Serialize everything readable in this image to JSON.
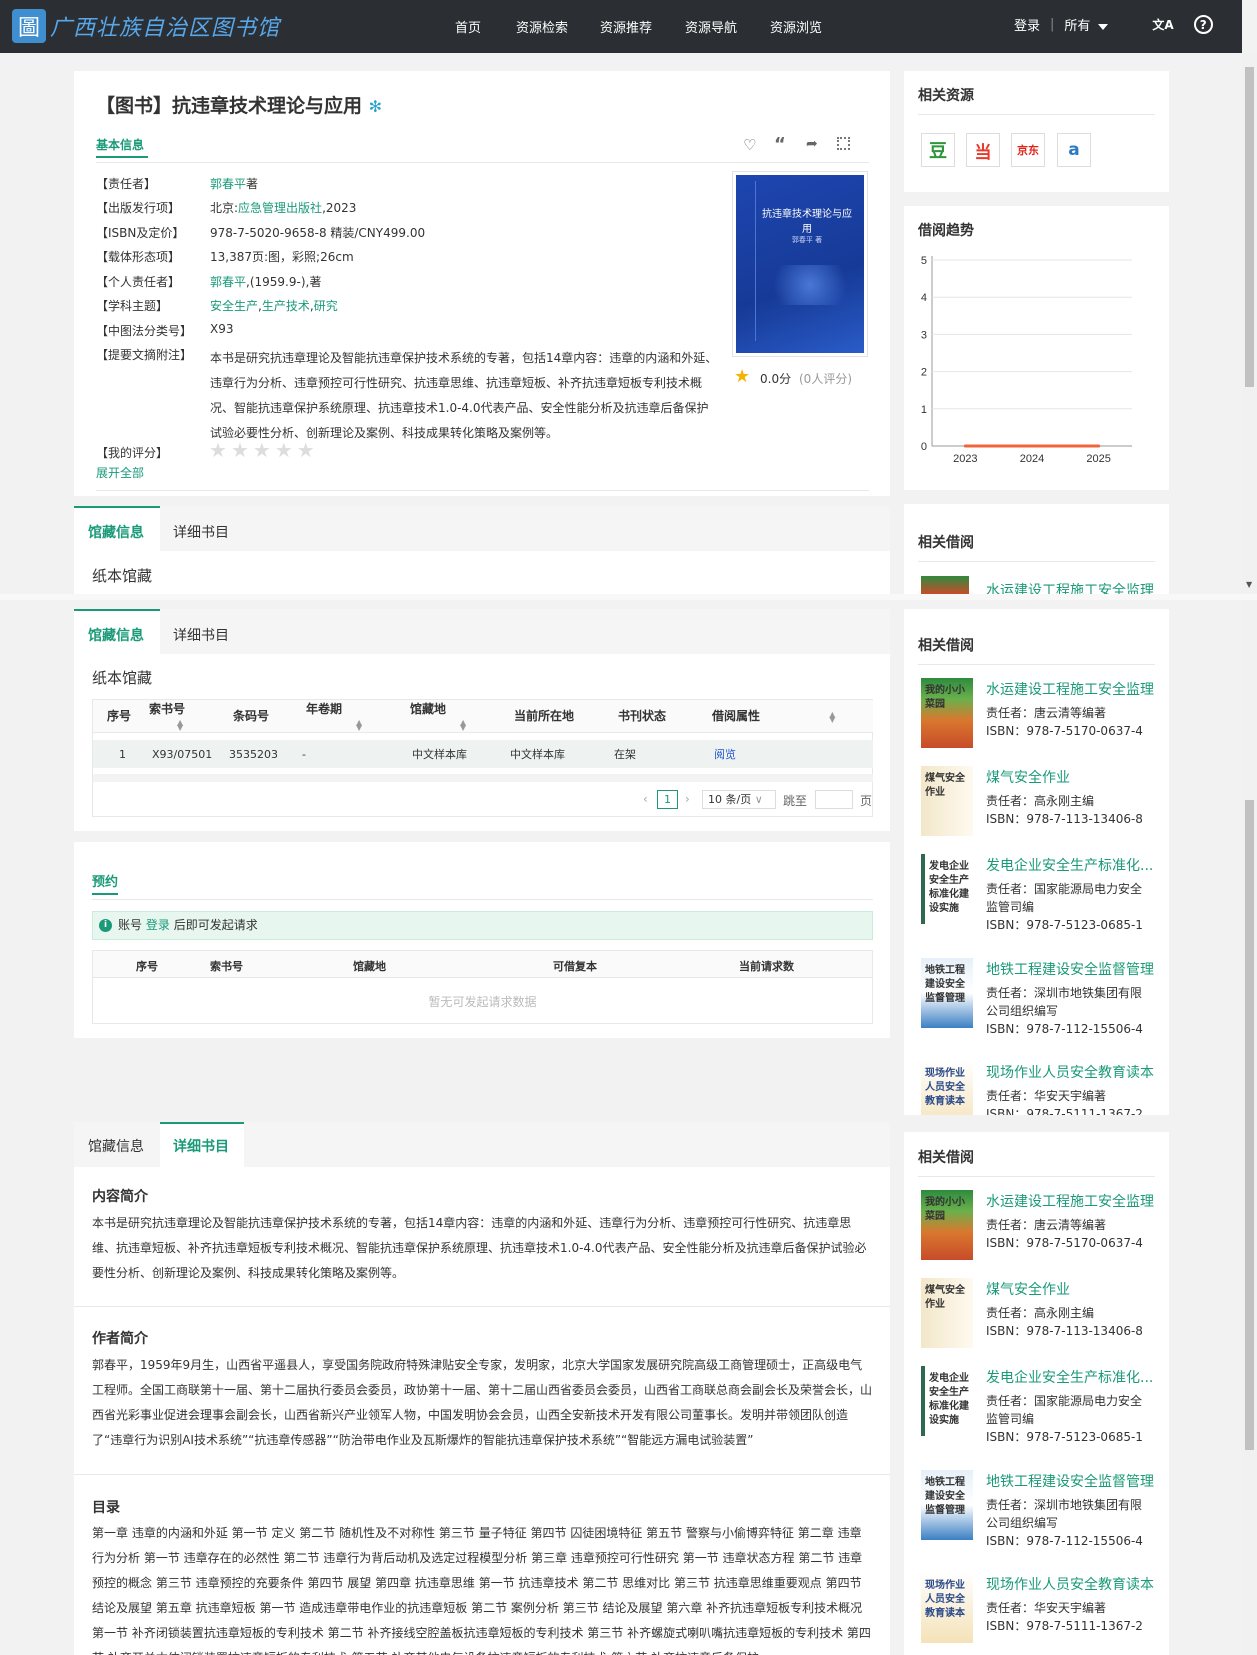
{
  "header": {
    "library_name": "广西壮族自治区图书馆",
    "logo_char": "圖",
    "nav": [
      "首页",
      "资源检索",
      "资源推荐",
      "资源导航",
      "资源浏览"
    ],
    "login": "登录",
    "scope": "所有",
    "lang_icon": "文A",
    "help_icon": "?"
  },
  "book": {
    "title": "【图书】抗违章技术理论与应用",
    "basic_tab": "基本信息",
    "fields": [
      {
        "label": "【责任者】",
        "value": "郭春平著"
      },
      {
        "label": "【出版发行项】",
        "value": "北京:应急管理出版社,2023"
      },
      {
        "label": "【ISBN及定价】",
        "value": "978-7-5020-9658-8 精装/CNY499.00"
      },
      {
        "label": "【载体形态项】",
        "value": "13,387页:图，彩照;26cm"
      },
      {
        "label": "【个人责任者】",
        "value": "郭春平,(1959.9-),著"
      },
      {
        "label": "【学科主题】",
        "value": "安全生产,生产技术,研究"
      },
      {
        "label": "【中图法分类号】",
        "value": "X93"
      },
      {
        "label": "【提要文摘附注】",
        "value": "本书是研究抗违章理论及智能抗违章保护技术系统的专著，包括14章内容：违章的内涵和外延、违章行为分析、违章预控可行性研究、抗违章思维、抗违章短板、补齐抗违章短板专利技术概况、智能抗违章保护系统原理、抗违章技术1.0-4.0代表产品、安全性能分析及抗违章后备保护试验必要性分析、创新理论及案例、科技成果转化策略及案例等。"
      },
      {
        "label": "【我的评分】",
        "value": ""
      }
    ],
    "author_link": "郭春平",
    "author_suffix": "著",
    "pub_prefix": "北京:",
    "pub_link": "应急管理出版社",
    "pub_suffix": ",2023",
    "pers_link": "郭春平",
    "pers_suffix": ",(1959.9-),著",
    "subj_links": [
      "安全生产",
      "生产技术",
      "研究"
    ],
    "expand": "展开全部",
    "rating": "0.0分",
    "rating_count": "(0人评分)",
    "cover_title": "抗违章技术理论与应用",
    "cover_author": "郭春平 著"
  },
  "related_resources": {
    "title": "相关资源",
    "sites": [
      "豆",
      "当",
      "京东",
      "a"
    ]
  },
  "trend": {
    "title": "借阅趋势"
  },
  "chart_data": {
    "type": "line",
    "x": [
      "2023",
      "2024",
      "2025"
    ],
    "series": [
      {
        "values": [
          0,
          0,
          0
        ]
      }
    ],
    "ylim": [
      0,
      5
    ],
    "yticks": [
      0,
      1,
      2,
      3,
      4,
      5
    ],
    "xlabel": "",
    "ylabel": "",
    "color": "#f0643c"
  },
  "holdings": {
    "tabs": [
      "馆藏信息",
      "详细书目"
    ],
    "paper": "纸本馆藏",
    "columns": [
      "序号",
      "索书号",
      "条码号",
      "年卷期",
      "馆藏地",
      "当前所在地",
      "书刊状态",
      "借阅属性"
    ],
    "rows": [
      [
        "1",
        "X93/07501",
        "3535203",
        "-",
        "中文样本库",
        "中文样本库",
        "在架",
        "阅览"
      ]
    ],
    "page": "1",
    "page_size": "10 条/页",
    "goto": "跳至",
    "page_unit": "页"
  },
  "reserve": {
    "title": "预约",
    "notice_prefix": "账号",
    "notice_link": "登录",
    "notice_suffix": "后即可发起请求",
    "columns": [
      "序号",
      "索书号",
      "馆藏地",
      "可借复本",
      "当前请求数"
    ],
    "empty": "暂无可发起请求数据"
  },
  "detail": {
    "intro_title": "内容简介",
    "intro": "本书是研究抗违章理论及智能抗违章保护技术系统的专著，包括14章内容：违章的内涵和外延、违章行为分析、违章预控可行性研究、抗违章思维、抗违章短板、补齐抗违章短板专利技术概况、智能抗违章保护系统原理、抗违章技术1.0-4.0代表产品、安全性能分析及抗违章后备保护试验必要性分析、创新理论及案例、科技成果转化策略及案例等。",
    "author_title": "作者简介",
    "author": "郭春平，1959年9月生，山西省平遥县人，享受国务院政府特殊津贴安全专家，发明家，北京大学国家发展研究院高级工商管理硕士，正高级电气工程师。全国工商联第十一届、第十二届执行委员会委员，政协第十一届、第十二届山西省委员会委员，山西省工商联总商会副会长及荣誉会长，山西省光彩事业促进会理事会副会长，山西省新兴产业领军人物，中国发明协会会员，山西全安新技术开发有限公司董事长。发明并带领团队创造了“违章行为识别AI技术系统”“抗违章传感器”“防治带电作业及瓦斯爆炸的智能抗违章保护技术系统”“智能远方漏电试验装置”",
    "toc_title": "目录",
    "toc": "第一章 违章的内涵和外延 第一节 定义 第二节 随机性及不对称性 第三节 量子特征 第四节 囚徒困境特征 第五节 警察与小偷博弈特征 第二章 违章行为分析 第一节 违章存在的必然性 第二节 违章行为背后动机及选定过程模型分析 第三章 违章预控可行性研究 第一节 违章状态方程 第二节 违章预控的概念 第三节 违章预控的充要条件 第四节 展望 第四章 抗违章思维 第一节 抗违章技术 第二节 思维对比 第三节 抗违章思维重要观点 第四节 结论及展望 第五章 抗违章短板 第一节 造成违章带电作业的抗违章短板 第二节 案例分析 第三节 结论及展望 第六章 补齐抗违章短板专利技术概况 第一节 补齐闭锁装置抗违章短板的专利技术 第二节 补齐接线空腔盖板抗违章短板的专利技术 第三节 补齐螺旋式喇叭嘴抗违章短板的专利技术 第四节 补齐开关本体闭锁装置抗违章短板的专利技术 第五节 补齐其他电气设备抗违章短板的专利技术 第六节 补齐抗违章后备保护"
  },
  "related_borrow": {
    "title": "相关借阅",
    "items": [
      {
        "title": "水运建设工程施工安全监理",
        "author": "责任者：唐云清等编著",
        "author2": "",
        "isbn": "ISBN：978-7-5170-0637-4",
        "cover_text": "我的小小菜园"
      },
      {
        "title": "煤气安全作业",
        "author": "责任者：高永刚主编",
        "author2": "",
        "isbn": "ISBN：978-7-113-13406-8",
        "cover_text": "煤气安全作业"
      },
      {
        "title": "发电企业安全生产标准化...",
        "author": "责任者：国家能源局电力安全",
        "author2": "监管司编",
        "isbn": "ISBN：978-7-5123-0685-1",
        "cover_text": "发电企业安全生产标准化建设实施"
      },
      {
        "title": "地铁工程建设安全监督管理",
        "author": "责任者：深圳市地铁集团有限",
        "author2": "公司组织编写",
        "isbn": "ISBN：978-7-112-15506-4",
        "cover_text": "地铁工程建设安全监督管理"
      },
      {
        "title": "现场作业人员安全教育读本",
        "author": "责任者：华安天宇编著",
        "author2": "",
        "isbn": "ISBN：978-7-5111-1367-2",
        "cover_text": "现场作业人员安全教育读本"
      }
    ]
  }
}
